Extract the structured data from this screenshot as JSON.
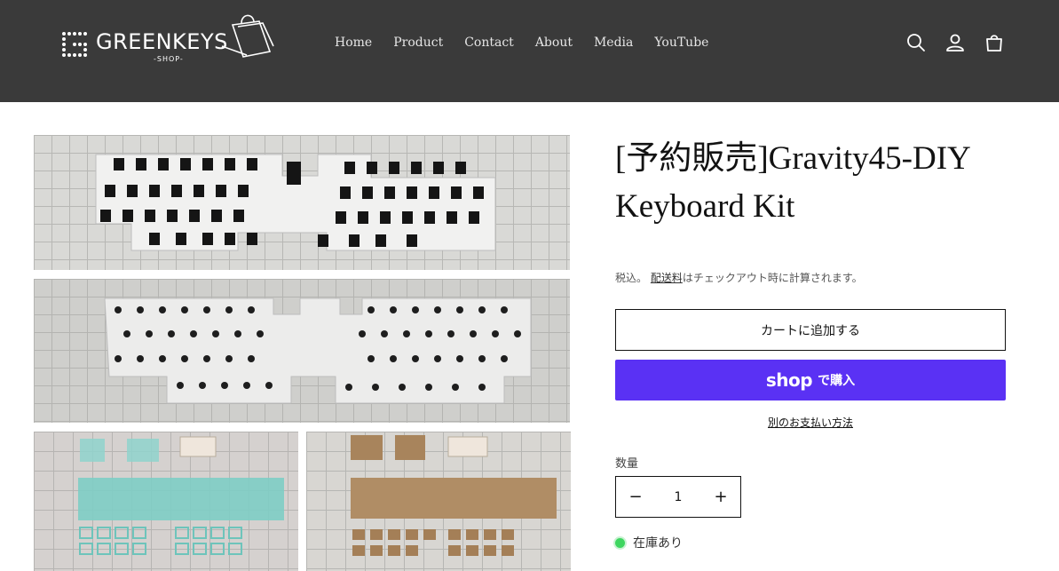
{
  "header": {
    "logo_text": "GREENKEYS",
    "logo_sub": "-SHOP-",
    "nav": [
      "Home",
      "Product",
      "Contact",
      "About",
      "Media",
      "YouTube"
    ],
    "icons": [
      "search-icon",
      "account-icon",
      "cart-icon"
    ]
  },
  "product": {
    "title": "[予約販売]Gravity45-DIY Keyboard Kit",
    "tax_prefix": "税込。",
    "tax_link": "配送料",
    "tax_suffix": "はチェックアウト時に計算されます。",
    "add_to_cart": "カートに追加する",
    "shop_word": "shop",
    "shop_buy": "で購入",
    "more_payment": "別のお支払い方法",
    "quantity_label": "数量",
    "quantity_value": "1",
    "minus": "−",
    "plus": "+",
    "stock": "在庫あり"
  },
  "colors": {
    "header_bg": "#3a3a3a",
    "shop_pay": "#5a31f4",
    "in_stock": "#3ed660"
  }
}
